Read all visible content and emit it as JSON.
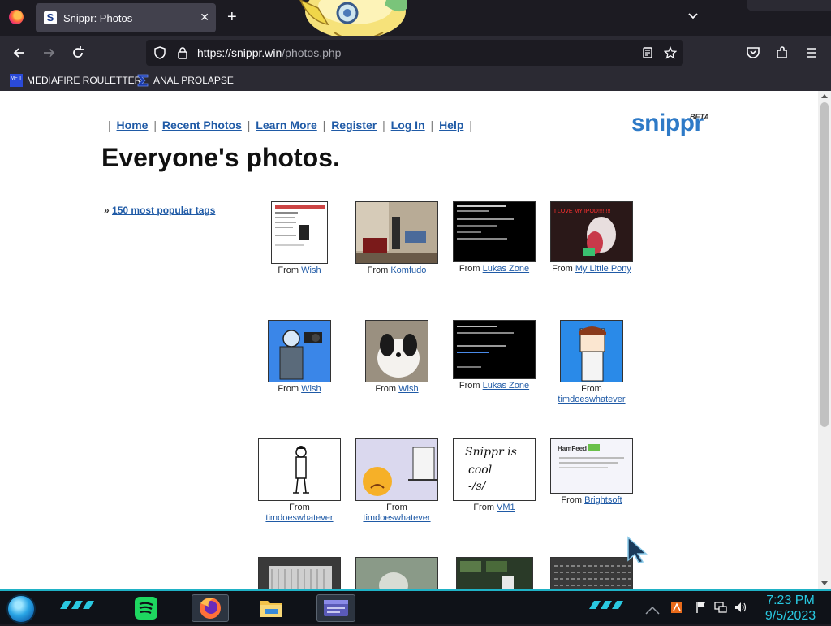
{
  "browser": {
    "tab_title": "Snippr: Photos",
    "tab_favicon_letter": "S",
    "close_glyph": "✕",
    "new_tab_glyph": "+",
    "url_host": "https://snippr.win",
    "url_path": "/photos.php",
    "bookmarks": [
      {
        "label": "MEDIAFIRE ROULETTER",
        "icon": "mediafire-icon",
        "icon_text": "MF T"
      },
      {
        "label": "ANAL PROLAPSE",
        "icon": "sigma-icon"
      }
    ]
  },
  "site": {
    "logo": "snippr",
    "logo_badge": "BETA",
    "nav_links": [
      "Home",
      "Recent Photos",
      "Learn More",
      "Register",
      "Log In",
      "Help"
    ],
    "separator": "|",
    "page_title": "Everyone's photos.",
    "tags_prefix": "»",
    "tags_link": "150 most popular tags",
    "from_label": "From"
  },
  "photos": [
    {
      "from": "Wish",
      "thumb": "screenshot-white"
    },
    {
      "from": "Komfudo",
      "thumb": "room-photo"
    },
    {
      "from": "Lukas Zone",
      "thumb": "terminal-dark"
    },
    {
      "from": "My Little Pony",
      "thumb": "ipod-pony",
      "thumb_text": "I LOVE MY IPOD!!!!!!!!"
    },
    {
      "from": "Wish",
      "thumb": "blue-drawing"
    },
    {
      "from": "Wish",
      "thumb": "dog-photo"
    },
    {
      "from": "Lukas Zone",
      "thumb": "terminal-dark"
    },
    {
      "from": "timdoeswhatever",
      "thumb": "cartoon-person"
    },
    {
      "from": "timdoeswhatever",
      "thumb": "stick-figure"
    },
    {
      "from": "timdoeswhatever",
      "thumb": "frown-emoji"
    },
    {
      "from": "VM1",
      "thumb": "handwriting",
      "thumb_text": "Snippr is cool -/s/"
    },
    {
      "from": "Brightsoft",
      "thumb": "hamfeed-screenshot",
      "thumb_text": "HamFeed"
    }
  ],
  "taskbar": {
    "time": "7:23 PM",
    "date": "9/5/2023",
    "apps": [
      "start-orb-icon",
      "spotify-icon",
      "firefox-icon",
      "file-explorer-icon",
      "window-icon"
    ],
    "tray_icons": [
      "network-icon",
      "flag-icon",
      "display-icon",
      "volume-icon"
    ]
  },
  "colors": {
    "link": "#1f5aa6",
    "logo": "#2e7ac7",
    "accent": "#1fb2c6",
    "clock": "#28c8e0"
  }
}
